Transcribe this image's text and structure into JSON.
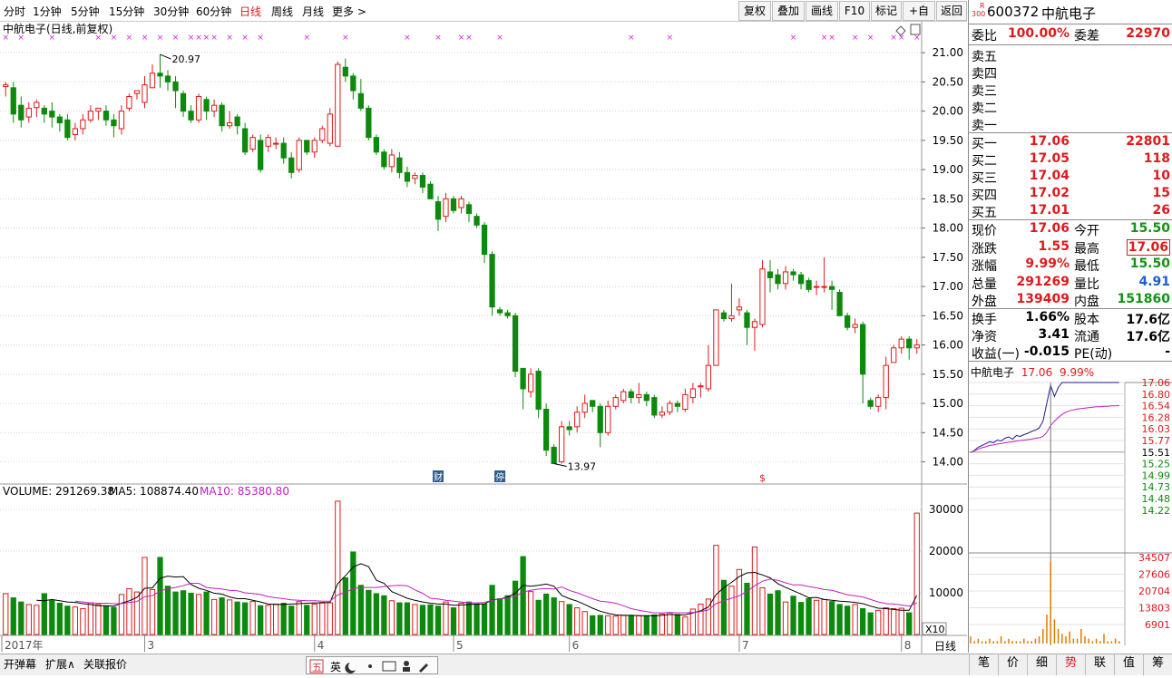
{
  "toolbar": {
    "periods": [
      "分时",
      "1分钟",
      "5分钟",
      "15分钟",
      "30分钟",
      "60分钟",
      "日线",
      "周线",
      "月线",
      "更多 >"
    ],
    "selected_period": "日线",
    "buttons": [
      "复权",
      "叠加",
      "画线",
      "F10",
      "标记",
      "+自选",
      "返回"
    ]
  },
  "stock": {
    "badge_top": "R",
    "badge_bottom": "300",
    "code": "600372",
    "name": "中航电子"
  },
  "order_book": {
    "wei_bi_label": "委比",
    "wei_bi": "100.00%",
    "wei_cha_label": "委差",
    "wei_cha": "22970",
    "asks": [
      {
        "label": "卖五",
        "price": "",
        "vol": ""
      },
      {
        "label": "卖四",
        "price": "",
        "vol": ""
      },
      {
        "label": "卖三",
        "price": "",
        "vol": ""
      },
      {
        "label": "卖二",
        "price": "",
        "vol": ""
      },
      {
        "label": "卖一",
        "price": "",
        "vol": ""
      }
    ],
    "bids": [
      {
        "label": "买一",
        "price": "17.06",
        "vol": "22801"
      },
      {
        "label": "买二",
        "price": "17.05",
        "vol": "118"
      },
      {
        "label": "买三",
        "price": "17.04",
        "vol": "10"
      },
      {
        "label": "买四",
        "price": "17.02",
        "vol": "15"
      },
      {
        "label": "买五",
        "price": "17.01",
        "vol": "26"
      }
    ]
  },
  "quote": {
    "rows": [
      {
        "k1": "现价",
        "v1": "17.06",
        "c1": "r",
        "k2": "今开",
        "v2": "15.50",
        "c2": "g"
      },
      {
        "k1": "涨跌",
        "v1": "1.55",
        "c1": "r",
        "k2": "最高",
        "v2": "17.06",
        "c2": "r"
      },
      {
        "k1": "涨幅",
        "v1": "9.99%",
        "c1": "r",
        "k2": "最低",
        "v2": "15.50",
        "c2": "g"
      },
      {
        "k1": "总量",
        "v1": "291269",
        "c1": "r",
        "k2": "量比",
        "v2": "4.91",
        "c2": "bl"
      },
      {
        "k1": "外盘",
        "v1": "139409",
        "c1": "r",
        "k2": "内盘",
        "v2": "151860",
        "c2": "g"
      }
    ],
    "rows2": [
      {
        "k1": "换手",
        "v1": "1.66%",
        "k2": "股本",
        "v2": "17.6亿"
      },
      {
        "k1": "净资",
        "v1": "3.41",
        "k2": "流通",
        "v2": "17.6亿"
      },
      {
        "k1": "收益(一)",
        "v1": "-0.015",
        "k2": "PE(动)",
        "v2": "-"
      }
    ]
  },
  "mini_chart": {
    "name": "中航电子",
    "price": "17.06",
    "pct": "9.99%",
    "price_ticks": [
      "17.06",
      "16.80",
      "16.54",
      "16.28",
      "16.03",
      "15.77",
      "15.51",
      "15.25",
      "14.99",
      "14.73",
      "14.48",
      "14.22"
    ],
    "vol_ticks": [
      "34507",
      "27606",
      "20704",
      "13803",
      "6901"
    ]
  },
  "chart_data": {
    "type": "candlestick",
    "title": "中航电子(日线,前复权)",
    "high_label": "20.97",
    "low_label": "13.97",
    "price_axis": [
      "21.00",
      "20.50",
      "20.00",
      "19.50",
      "19.00",
      "18.50",
      "18.00",
      "17.50",
      "17.00",
      "16.50",
      "16.00",
      "15.50",
      "15.00",
      "14.50",
      "14.00"
    ],
    "ylim": [
      13.9,
      21.25
    ],
    "volume_label": "VOLUME: 291269.38",
    "ma5_label": "MA5: 108874.40",
    "ma10_label": "MA10: 85380.80",
    "volume_axis": [
      "30000",
      "20000",
      "10000"
    ],
    "volume_unit": "X10",
    "x_axis_labels": [
      {
        "i": 0,
        "t": "2017年"
      },
      {
        "i": 18,
        "t": "3"
      },
      {
        "i": 40,
        "t": "4"
      },
      {
        "i": 58,
        "t": "5"
      },
      {
        "i": 73,
        "t": "6"
      },
      {
        "i": 95,
        "t": "7"
      },
      {
        "i": 116,
        "t": "8"
      }
    ],
    "period_label": "日线",
    "event_marks": [
      {
        "i": 56,
        "t": "财"
      },
      {
        "i": 64,
        "t": "停"
      }
    ],
    "dividend_mark": {
      "i": 98,
      "t": "$"
    },
    "candles": [
      [
        20.42,
        20.45,
        20.25,
        20.5
      ],
      [
        20.4,
        19.95,
        19.8,
        20.5
      ],
      [
        20.1,
        19.85,
        19.72,
        20.25
      ],
      [
        19.9,
        20.05,
        19.8,
        20.15
      ],
      [
        20.06,
        20.15,
        19.9,
        20.2
      ],
      [
        20.05,
        19.95,
        19.8,
        20.1
      ],
      [
        20.0,
        19.9,
        19.72,
        20.15
      ],
      [
        19.9,
        19.8,
        19.65,
        19.95
      ],
      [
        19.85,
        19.55,
        19.5,
        19.95
      ],
      [
        19.6,
        19.7,
        19.5,
        19.8
      ],
      [
        19.7,
        19.85,
        19.6,
        19.95
      ],
      [
        19.85,
        20.0,
        19.8,
        20.1
      ],
      [
        20.0,
        20.05,
        19.85,
        20.05
      ],
      [
        20.0,
        19.85,
        19.75,
        20.1
      ],
      [
        19.85,
        19.75,
        19.55,
        19.95
      ],
      [
        19.7,
        20.0,
        19.6,
        20.1
      ],
      [
        20.05,
        20.25,
        20.0,
        20.3
      ],
      [
        20.3,
        20.35,
        20.2,
        20.35
      ],
      [
        20.15,
        20.45,
        20.05,
        20.6
      ],
      [
        20.4,
        20.65,
        20.4,
        20.8
      ],
      [
        20.65,
        20.6,
        20.4,
        20.97
      ],
      [
        20.6,
        20.5,
        20.35,
        20.7
      ],
      [
        20.5,
        20.35,
        20.05,
        20.6
      ],
      [
        20.3,
        20.0,
        19.9,
        20.35
      ],
      [
        20.0,
        19.85,
        19.8,
        20.1
      ],
      [
        19.85,
        20.25,
        19.8,
        20.3
      ],
      [
        20.2,
        20.0,
        19.85,
        20.25
      ],
      [
        20.0,
        20.1,
        19.9,
        20.2
      ],
      [
        20.1,
        19.75,
        19.65,
        20.15
      ],
      [
        19.75,
        19.8,
        19.7,
        20.0
      ],
      [
        19.9,
        19.75,
        19.6,
        19.95
      ],
      [
        19.7,
        19.3,
        19.25,
        19.8
      ],
      [
        19.35,
        19.55,
        19.3,
        19.6
      ],
      [
        19.5,
        19.0,
        18.95,
        19.6
      ],
      [
        19.4,
        19.55,
        19.3,
        19.6
      ],
      [
        19.45,
        19.45,
        19.35,
        19.55
      ],
      [
        19.45,
        19.2,
        19.1,
        19.55
      ],
      [
        19.2,
        18.95,
        18.85,
        19.3
      ],
      [
        19.0,
        19.5,
        18.95,
        19.55
      ],
      [
        19.5,
        19.3,
        19.25,
        19.5
      ],
      [
        19.3,
        19.5,
        19.2,
        19.55
      ],
      [
        19.5,
        19.7,
        19.45,
        19.75
      ],
      [
        19.45,
        19.95,
        19.4,
        20.05
      ],
      [
        19.4,
        20.8,
        19.4,
        20.85
      ],
      [
        20.75,
        20.6,
        20.5,
        20.9
      ],
      [
        20.6,
        20.35,
        20.2,
        20.65
      ],
      [
        20.3,
        20.05,
        20.0,
        20.55
      ],
      [
        20.05,
        19.55,
        19.5,
        20.1
      ],
      [
        19.55,
        19.3,
        19.25,
        19.6
      ],
      [
        19.3,
        19.05,
        19.0,
        19.35
      ],
      [
        19.05,
        19.25,
        18.95,
        19.35
      ],
      [
        19.2,
        18.95,
        18.85,
        19.3
      ],
      [
        18.95,
        18.8,
        18.7,
        19.05
      ],
      [
        18.85,
        18.9,
        18.75,
        18.95
      ],
      [
        18.9,
        18.7,
        18.6,
        18.95
      ],
      [
        18.75,
        18.5,
        18.5,
        18.8
      ],
      [
        18.45,
        18.15,
        17.95,
        18.55
      ],
      [
        18.2,
        18.5,
        18.1,
        18.6
      ],
      [
        18.5,
        18.3,
        18.25,
        18.55
      ],
      [
        18.35,
        18.5,
        18.25,
        18.55
      ],
      [
        18.4,
        18.25,
        18.1,
        18.45
      ],
      [
        18.2,
        18.05,
        18.0,
        18.25
      ],
      [
        18.05,
        17.55,
        17.4,
        18.1
      ],
      [
        17.55,
        16.65,
        16.5,
        17.6
      ],
      [
        16.6,
        16.55,
        16.5,
        16.65
      ],
      [
        16.55,
        16.5,
        16.45,
        16.6
      ],
      [
        16.5,
        15.55,
        15.45,
        16.55
      ],
      [
        15.6,
        15.25,
        14.9,
        15.6
      ],
      [
        15.2,
        15.5,
        15.1,
        15.6
      ],
      [
        15.55,
        14.9,
        14.75,
        15.6
      ],
      [
        14.9,
        14.2,
        14.1,
        15.0
      ],
      [
        14.25,
        13.97,
        13.97,
        14.3
      ],
      [
        14.0,
        14.6,
        13.97,
        14.7
      ],
      [
        14.6,
        14.55,
        14.45,
        14.7
      ],
      [
        14.6,
        14.85,
        14.5,
        14.95
      ],
      [
        14.85,
        15.0,
        14.75,
        15.15
      ],
      [
        15.05,
        14.95,
        14.85,
        15.05
      ],
      [
        14.95,
        14.5,
        14.25,
        15.0
      ],
      [
        14.5,
        14.95,
        14.45,
        15.05
      ],
      [
        14.95,
        15.1,
        14.9,
        15.15
      ],
      [
        15.05,
        15.2,
        15.0,
        15.25
      ],
      [
        15.2,
        15.1,
        15.0,
        15.25
      ],
      [
        15.1,
        15.15,
        15.0,
        15.35
      ],
      [
        15.15,
        15.05,
        14.95,
        15.2
      ],
      [
        15.1,
        14.8,
        14.75,
        15.15
      ],
      [
        14.8,
        14.85,
        14.75,
        14.95
      ],
      [
        14.85,
        15.0,
        14.8,
        15.05
      ],
      [
        15.0,
        14.95,
        14.85,
        15.05
      ],
      [
        14.9,
        15.15,
        14.85,
        15.25
      ],
      [
        15.1,
        15.25,
        15.0,
        15.35
      ],
      [
        15.3,
        15.3,
        15.1,
        15.35
      ],
      [
        15.25,
        15.65,
        15.2,
        16.0
      ],
      [
        15.65,
        16.6,
        15.65,
        16.6
      ],
      [
        16.55,
        16.45,
        16.4,
        16.6
      ],
      [
        16.45,
        16.5,
        16.4,
        17.05
      ],
      [
        16.6,
        16.65,
        16.5,
        16.8
      ],
      [
        16.55,
        16.3,
        16.0,
        16.6
      ],
      [
        16.3,
        16.4,
        15.9,
        16.45
      ],
      [
        16.35,
        17.3,
        16.3,
        17.45
      ],
      [
        17.25,
        17.15,
        16.9,
        17.45
      ],
      [
        17.2,
        17.05,
        16.95,
        17.3
      ],
      [
        17.05,
        17.25,
        16.95,
        17.35
      ],
      [
        17.25,
        17.2,
        17.1,
        17.3
      ],
      [
        17.2,
        17.05,
        16.95,
        17.25
      ],
      [
        17.1,
        16.95,
        16.9,
        17.15
      ],
      [
        17.0,
        17.0,
        16.85,
        17.1
      ],
      [
        17.0,
        17.0,
        16.9,
        17.5
      ],
      [
        17.0,
        16.95,
        16.6,
        17.1
      ],
      [
        16.9,
        16.5,
        16.5,
        16.95
      ],
      [
        16.5,
        16.3,
        16.25,
        16.55
      ],
      [
        16.3,
        16.35,
        16.2,
        16.45
      ],
      [
        16.35,
        15.5,
        15.0,
        16.4
      ],
      [
        15.05,
        14.95,
        14.9,
        15.1
      ],
      [
        14.95,
        15.1,
        14.85,
        15.15
      ],
      [
        15.1,
        15.65,
        14.9,
        15.8
      ],
      [
        15.7,
        15.95,
        15.7,
        16.0
      ],
      [
        15.95,
        16.1,
        15.85,
        16.15
      ],
      [
        16.1,
        15.95,
        15.75,
        16.15
      ],
      [
        15.95,
        16.0,
        15.85,
        16.1
      ]
    ],
    "volume": [
      9800,
      8800,
      7800,
      7200,
      7000,
      9800,
      8200,
      7500,
      6800,
      6600,
      6200,
      7600,
      7200,
      6800,
      6500,
      9600,
      11000,
      10200,
      18500,
      10800,
      18500,
      11600,
      10200,
      10500,
      9900,
      9600,
      10200,
      8400,
      8800,
      8300,
      7800,
      7600,
      7900,
      6900,
      7000,
      7300,
      7500,
      6800,
      7900,
      7000,
      7300,
      7700,
      7600,
      32000,
      13600,
      19800,
      11800,
      10600,
      9800,
      9300,
      8100,
      7600,
      7600,
      7200,
      7000,
      7100,
      6800,
      7800,
      6400,
      7500,
      7800,
      7200,
      7300,
      11800,
      8600,
      9300,
      12800,
      18700,
      10300,
      8200,
      9700,
      8800,
      7900,
      7200,
      6400,
      5500,
      4500,
      4600,
      4500,
      4400,
      4600,
      4600,
      4500,
      4500,
      4700,
      4900,
      5200,
      4800,
      4200,
      6100,
      7300,
      8500,
      21400,
      13000,
      11600,
      15600,
      12300,
      21000,
      11200,
      9700,
      10500,
      7800,
      9200,
      7700,
      8600,
      8200,
      8400,
      7900,
      7200,
      6800,
      7200,
      6200,
      5200,
      5800,
      6400,
      6200,
      6300,
      5200,
      29127
    ],
    "ma5": [
      null,
      null,
      null,
      null,
      8200,
      8100,
      8400,
      8100,
      7800,
      7700,
      7400,
      7200,
      6900,
      6900,
      6800,
      7500,
      8100,
      8900,
      11100,
      11200,
      13500,
      14000,
      13800,
      13900,
      12000,
      11100,
      10600,
      9900,
      9700,
      9000,
      8600,
      8600,
      8200,
      7800,
      7300,
      7200,
      7200,
      7300,
      7400,
      7500,
      7600,
      7600,
      7700,
      12200,
      14100,
      16200,
      17000,
      16300,
      13000,
      12300,
      10300,
      9500,
      8700,
      8200,
      7800,
      7500,
      7300,
      7300,
      7000,
      7100,
      7200,
      7300,
      7300,
      8300,
      8500,
      9000,
      9900,
      11800,
      11600,
      11800,
      12100,
      11600,
      9400,
      8600,
      8000,
      7200,
      6300,
      5600,
      5100,
      4700,
      4600,
      4600,
      4500,
      4500,
      4500,
      4600,
      4800,
      4700,
      4700,
      5200,
      5700,
      6600,
      9600,
      11200,
      12500,
      13900,
      14800,
      14900,
      14300,
      13600,
      12200,
      11300,
      10500,
      9700,
      8800,
      8900,
      8400,
      8200,
      8000,
      7900,
      7700,
      7400,
      6800,
      6300,
      6200,
      6000,
      5800,
      5800,
      9400
    ],
    "ma10": [
      null,
      null,
      null,
      null,
      null,
      null,
      null,
      null,
      null,
      8000,
      7800,
      7600,
      7500,
      7500,
      7400,
      7400,
      7700,
      7900,
      9100,
      9300,
      10400,
      11000,
      11300,
      11700,
      12300,
      12300,
      11300,
      11100,
      10900,
      10600,
      10500,
      10000,
      9800,
      9600,
      9100,
      8800,
      8600,
      8300,
      8200,
      8100,
      8100,
      8000,
      8000,
      9500,
      10100,
      11000,
      11300,
      11300,
      11300,
      11500,
      11700,
      11800,
      11700,
      10700,
      9900,
      8700,
      8500,
      8200,
      8000,
      7800,
      7600,
      7600,
      7700,
      8200,
      8500,
      8800,
      9100,
      10200,
      10600,
      10900,
      11000,
      10900,
      11400,
      10600,
      10000,
      9300,
      8600,
      8000,
      7800,
      7500,
      6900,
      6200,
      5800,
      5500,
      5200,
      5200,
      5300,
      5200,
      5200,
      5300,
      5500,
      5900,
      7400,
      8100,
      8700,
      9300,
      10300,
      11700,
      12800,
      13300,
      13000,
      12400,
      11900,
      11900,
      11500,
      11200,
      10800,
      10600,
      10100,
      9500,
      9300,
      9000,
      8400,
      7800,
      7400,
      7300,
      7100,
      6800,
      7600
    ]
  }
}
